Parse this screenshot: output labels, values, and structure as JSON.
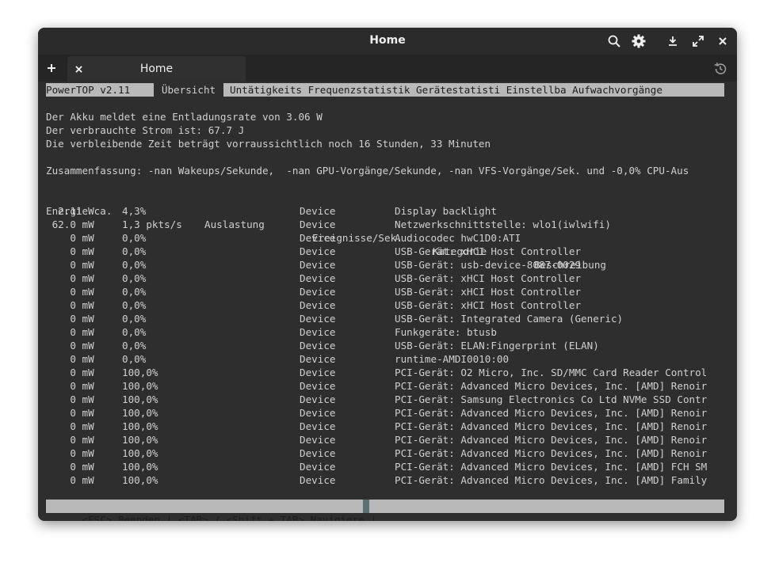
{
  "window": {
    "title": "Home",
    "tab_label": "Home"
  },
  "terminal": {
    "menu": {
      "app": "PowerTOP v2.11",
      "active": "Übersicht",
      "rest": "Untätigkeits Frequenzstatistik Gerätestatisti Einstellba Aufwachvorgänge"
    },
    "summary_lines": [
      "Der Akku meldet eine Entladungsrate von 3.06 W",
      "Der verbrauchte Strom ist: 67.7 J",
      "Die verbleibende Zeit beträgt vorraussichtlich noch 16 Stunden, 33 Minuten"
    ],
    "overview": "Zusammenfassung: -nan Wakeups/Sekunde,  -nan GPU-Vorgänge/Sekunde, -nan VFS-Vorgänge/Sek. und -0,0% CPU-Aus",
    "headers": {
      "energy": "Energie ca.",
      "usage": "Auslastung",
      "events": "Ereignisse/Sek.",
      "category": "Kategorie",
      "description": "Beschreibung"
    },
    "rows": [
      {
        "energy": "  2.11 W",
        "usage": "4,3%",
        "category": "Device",
        "description": "Display backlight"
      },
      {
        "energy": " 62.0 mW",
        "usage": "1,3 pkts/s",
        "category": "Device",
        "description": "Netzwerkschnittstelle: wlo1(iwlwifi)"
      },
      {
        "energy": "    0 mW",
        "usage": "0,0%",
        "category": "Device",
        "description": "Audiocodec hwC1D0:ATI"
      },
      {
        "energy": "    0 mW",
        "usage": "0,0%",
        "category": "Device",
        "description": "USB-Gerät: xHCI Host Controller"
      },
      {
        "energy": "    0 mW",
        "usage": "0,0%",
        "category": "Device",
        "description": "USB-Gerät: usb-device-8087-0029"
      },
      {
        "energy": "    0 mW",
        "usage": "0,0%",
        "category": "Device",
        "description": "USB-Gerät: xHCI Host Controller"
      },
      {
        "energy": "    0 mW",
        "usage": "0,0%",
        "category": "Device",
        "description": "USB-Gerät: xHCI Host Controller"
      },
      {
        "energy": "    0 mW",
        "usage": "0,0%",
        "category": "Device",
        "description": "USB-Gerät: xHCI Host Controller"
      },
      {
        "energy": "    0 mW",
        "usage": "0,0%",
        "category": "Device",
        "description": "USB-Gerät: Integrated Camera (Generic)"
      },
      {
        "energy": "    0 mW",
        "usage": "0,0%",
        "category": "Device",
        "description": "Funkgeräte: btusb"
      },
      {
        "energy": "    0 mW",
        "usage": "0,0%",
        "category": "Device",
        "description": "USB-Gerät: ELAN:Fingerprint (ELAN)"
      },
      {
        "energy": "    0 mW",
        "usage": "0,0%",
        "category": "Device",
        "description": "runtime-AMDI0010:00"
      },
      {
        "energy": "    0 mW",
        "usage": "100,0%",
        "category": "Device",
        "description": "PCI-Gerät: O2 Micro, Inc. SD/MMC Card Reader Control"
      },
      {
        "energy": "    0 mW",
        "usage": "100,0%",
        "category": "Device",
        "description": "PCI-Gerät: Advanced Micro Devices, Inc. [AMD] Renoir"
      },
      {
        "energy": "    0 mW",
        "usage": "100,0%",
        "category": "Device",
        "description": "PCI-Gerät: Samsung Electronics Co Ltd NVMe SSD Contr"
      },
      {
        "energy": "    0 mW",
        "usage": "100,0%",
        "category": "Device",
        "description": "PCI-Gerät: Advanced Micro Devices, Inc. [AMD] Renoir"
      },
      {
        "energy": "    0 mW",
        "usage": "100,0%",
        "category": "Device",
        "description": "PCI-Gerät: Advanced Micro Devices, Inc. [AMD] Renoir"
      },
      {
        "energy": "    0 mW",
        "usage": "100,0%",
        "category": "Device",
        "description": "PCI-Gerät: Advanced Micro Devices, Inc. [AMD] Renoir"
      },
      {
        "energy": "    0 mW",
        "usage": "100,0%",
        "category": "Device",
        "description": "PCI-Gerät: Advanced Micro Devices, Inc. [AMD] Renoir"
      },
      {
        "energy": "    0 mW",
        "usage": "100,0%",
        "category": "Device",
        "description": "PCI-Gerät: Advanced Micro Devices, Inc. [AMD] FCH SM"
      },
      {
        "energy": "    0 mW",
        "usage": "100,0%",
        "category": "Device",
        "description": "PCI-Gerät: Advanced Micro Devices, Inc. [AMD] Family"
      }
    ],
    "status": "<ESC> Beenden | <TAB> / <Shift + TAB> Navigiere |"
  },
  "icons": {
    "search": "search-icon",
    "settings": "gear-icon",
    "download": "download-icon",
    "fullscreen": "fullscreen-icon",
    "close": "close-icon",
    "new_tab": "plus-icon",
    "tab_close": "close-icon",
    "history": "history-icon"
  },
  "colors": {
    "window_bg": "#2e2e2e",
    "terminal_fg": "#d0d0d0",
    "highlight_bg": "#b9b9b9",
    "cursor": "#5d7072"
  }
}
